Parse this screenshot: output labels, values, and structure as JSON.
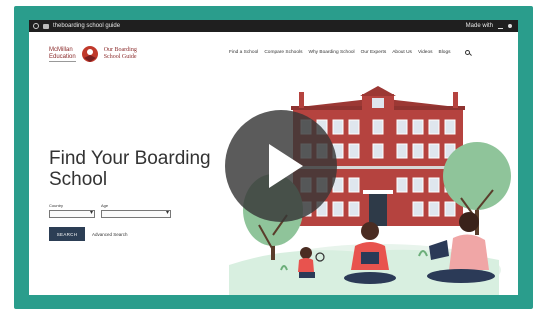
{
  "browser": {
    "tab_title": "theboarding school guide",
    "right_label": "Made with"
  },
  "logo": {
    "left_line1": "McMillan",
    "left_line2": "Education",
    "right_line1": "Our Boarding",
    "right_line2": "School Guide"
  },
  "nav": {
    "items": [
      "Find a School",
      "Compare Schools",
      "Why Boarding School",
      "Our Experts",
      "About Us",
      "Videos",
      "Blogs"
    ]
  },
  "hero": {
    "title_line1": "Find Your Boarding",
    "title_line2": "School"
  },
  "form": {
    "country_label": "Country",
    "age_label": "Age",
    "search_button": "SEARCH",
    "advanced_link": "Advanced Search"
  },
  "colors": {
    "frame": "#2a9d8c",
    "building": "#b5433f",
    "button": "#2c3e55"
  },
  "icons": {
    "play": "play-icon",
    "search": "search-icon"
  }
}
